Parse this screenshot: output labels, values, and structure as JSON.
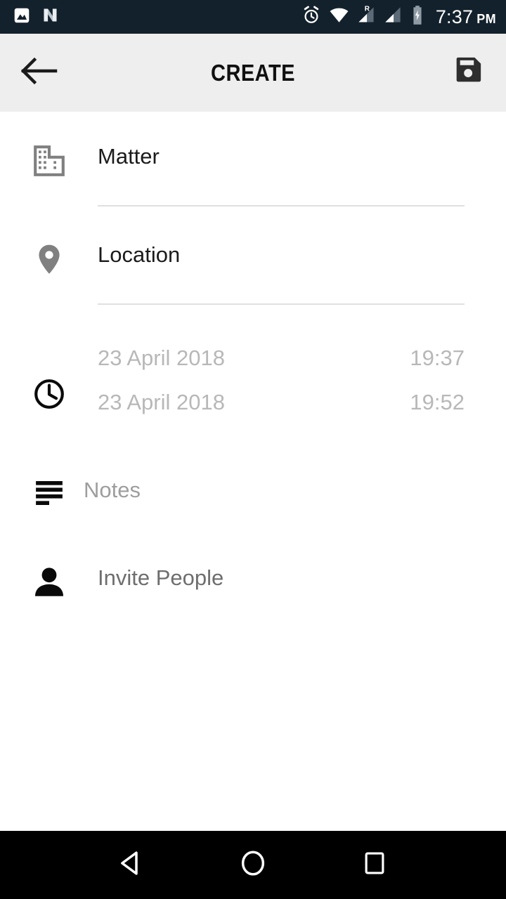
{
  "statusbar": {
    "background": "#13212c",
    "left_icons": [
      {
        "name": "image-icon",
        "label": "Photo"
      },
      {
        "name": "nougat-icon",
        "label": "Android N"
      }
    ],
    "right_icons": [
      {
        "name": "alarm-icon",
        "label": "Alarm set"
      },
      {
        "name": "wifi-icon",
        "label": "Wi-Fi"
      },
      {
        "name": "signal-roaming-icon",
        "label": "R"
      },
      {
        "name": "signal-icon",
        "label": "Signal"
      },
      {
        "name": "battery-charging-icon",
        "label": "Charging"
      }
    ],
    "roaming_badge": "R",
    "time": "7:37",
    "ampm": "PM"
  },
  "toolbar": {
    "background": "#eeeeee",
    "back_icon": "arrow-back-icon",
    "title": "CREATE",
    "save_icon": "save-floppy-icon"
  },
  "form": {
    "matter": {
      "icon": "business-building-icon",
      "value": "Matter",
      "placeholder": "Matter",
      "filled": true
    },
    "location": {
      "icon": "map-pin-icon",
      "value": "Location",
      "placeholder": "Location",
      "filled": true
    },
    "schedule": {
      "icon": "clock-icon",
      "start": {
        "date": "23 April 2018",
        "time": "19:37"
      },
      "end": {
        "date": "23 April 2018",
        "time": "19:52"
      }
    },
    "notes": {
      "icon": "notes-lines-icon",
      "value": "Notes",
      "placeholder": "Notes",
      "filled": false
    },
    "invite": {
      "icon": "person-icon",
      "label": "Invite People"
    }
  },
  "navbar": {
    "background": "#000000",
    "buttons": [
      {
        "name": "nav-back-button",
        "icon": "triangle-back-icon"
      },
      {
        "name": "nav-home-button",
        "icon": "circle-home-icon"
      },
      {
        "name": "nav-recents-button",
        "icon": "square-recents-icon"
      }
    ]
  },
  "colors": {
    "toolbar_bg": "#eeeeee",
    "statusbar_bg": "#13212c",
    "navbar_bg": "#000000",
    "text_primary": "#1b1b1b",
    "text_placeholder": "#9e9e9e",
    "text_muted": "#b8b8b8",
    "divider": "#e0e0e0",
    "icon_gray": "#808080",
    "icon_dark": "#0a0a0a"
  }
}
